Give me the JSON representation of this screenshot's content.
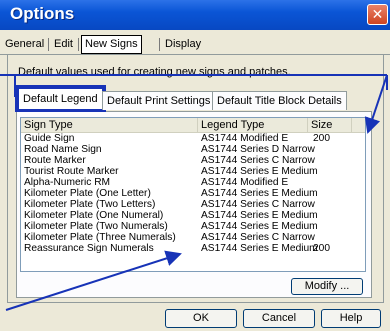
{
  "window": {
    "title": "Options",
    "close_glyph": "✕"
  },
  "top_tabs": [
    {
      "label": "General"
    },
    {
      "label": "Edit"
    },
    {
      "label": "New Signs"
    },
    {
      "label": "Display"
    }
  ],
  "description": "Default values used for creating new signs and patches.",
  "inner_tabs": [
    {
      "label": "Default Legend"
    },
    {
      "label": "Default Print Settings"
    },
    {
      "label": "Default Title Block Details"
    }
  ],
  "list": {
    "columns": [
      "Sign Type",
      "Legend Type",
      "Size"
    ],
    "rows": [
      {
        "sign_type": "Guide Sign",
        "legend_type": "AS1744 Modified E",
        "size": "200"
      },
      {
        "sign_type": "Road Name Sign",
        "legend_type": "AS1744 Series D Narrow",
        "size": ""
      },
      {
        "sign_type": "Route Marker",
        "legend_type": "AS1744 Series C Narrow",
        "size": ""
      },
      {
        "sign_type": "Tourist Route Marker",
        "legend_type": "AS1744 Series E Medium",
        "size": ""
      },
      {
        "sign_type": "Alpha-Numeric RM",
        "legend_type": "AS1744 Modified E",
        "size": ""
      },
      {
        "sign_type": "Kilometer Plate (One Letter)",
        "legend_type": "AS1744 Series E Medium",
        "size": ""
      },
      {
        "sign_type": "Kilometer Plate (Two Letters)",
        "legend_type": "AS1744 Series C Narrow",
        "size": ""
      },
      {
        "sign_type": "Kilometer Plate (One Numeral)",
        "legend_type": "AS1744 Series E Medium",
        "size": ""
      },
      {
        "sign_type": "Kilometer Plate (Two Numerals)",
        "legend_type": "AS1744 Series E Medium",
        "size": ""
      },
      {
        "sign_type": "Kilometer Plate (Three Numerals)",
        "legend_type": "AS1744 Series C Narrow",
        "size": ""
      },
      {
        "sign_type": "Reassurance Sign Numerals",
        "legend_type": "AS1744 Series E Medium",
        "size": "200"
      }
    ]
  },
  "buttons": {
    "modify": "Modify ...",
    "ok": "OK",
    "cancel": "Cancel",
    "help": "Help"
  },
  "colors": {
    "titlebar": "#0a55d6",
    "highlight": "#1733b7",
    "dialog_bg": "#ece9d8"
  }
}
